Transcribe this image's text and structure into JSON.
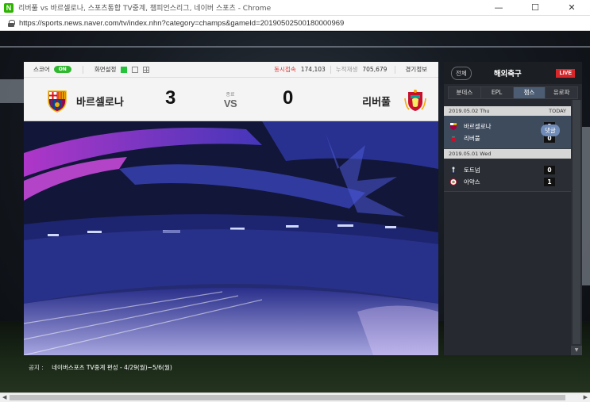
{
  "window": {
    "title": "리버풀 vs 바르셀로나, 스포츠통합 TV중계, 챔피언스리그, 네이버 스포츠 - Chrome",
    "favicon_letter": "N",
    "minimize": "—",
    "maximize": "☐",
    "close": "✕",
    "url": "https://sports.news.naver.com/tv/index.nhn?category=champs&gameId=20190502500180000969"
  },
  "scoreboard": {
    "score_label": "스코어",
    "score_toggle": "ON",
    "view_label": "화면설정",
    "concurrent_label": "동시접속",
    "concurrent_value": "174,103",
    "cumulative_label": "누적재생",
    "cumulative_value": "705,679",
    "game_info": "경기정보",
    "home_team": "바르셀로나",
    "home_score": "3",
    "away_team": "리버풀",
    "away_score": "0",
    "status": "종료",
    "vs": "VS"
  },
  "sidebar": {
    "all_button": "전체",
    "title": "해외축구",
    "live_tag": "LIVE",
    "tabs": [
      "분데스",
      "EPL",
      "챔스",
      "유로파"
    ],
    "active_tab": "챔스",
    "days": [
      {
        "date": "2019.05.02 Thu",
        "today": "TODAY",
        "home": "바르셀로나",
        "home_score": "3",
        "away": "리버풀",
        "away_score": "0",
        "reply": "댓글"
      },
      {
        "date": "2019.05.01 Wed",
        "home": "토트넘",
        "home_score": "0",
        "away": "아약스",
        "away_score": "1"
      }
    ]
  },
  "notice": {
    "label": "공지 :",
    "text": "네이버스포츠 TV중계 편성 - 4/29(월)~5/6(월)"
  },
  "colors": {
    "on_green": "#2eb82e",
    "live_red": "#d7262a",
    "tab_active": "#4b5c73",
    "sidebar_bg": "#262a30"
  },
  "icons": [
    "lock-icon",
    "minimize-icon",
    "maximize-icon",
    "close-icon",
    "barcelona-crest-icon",
    "liverpool-crest-icon",
    "tottenham-crest-icon",
    "ajax-crest-icon"
  ]
}
